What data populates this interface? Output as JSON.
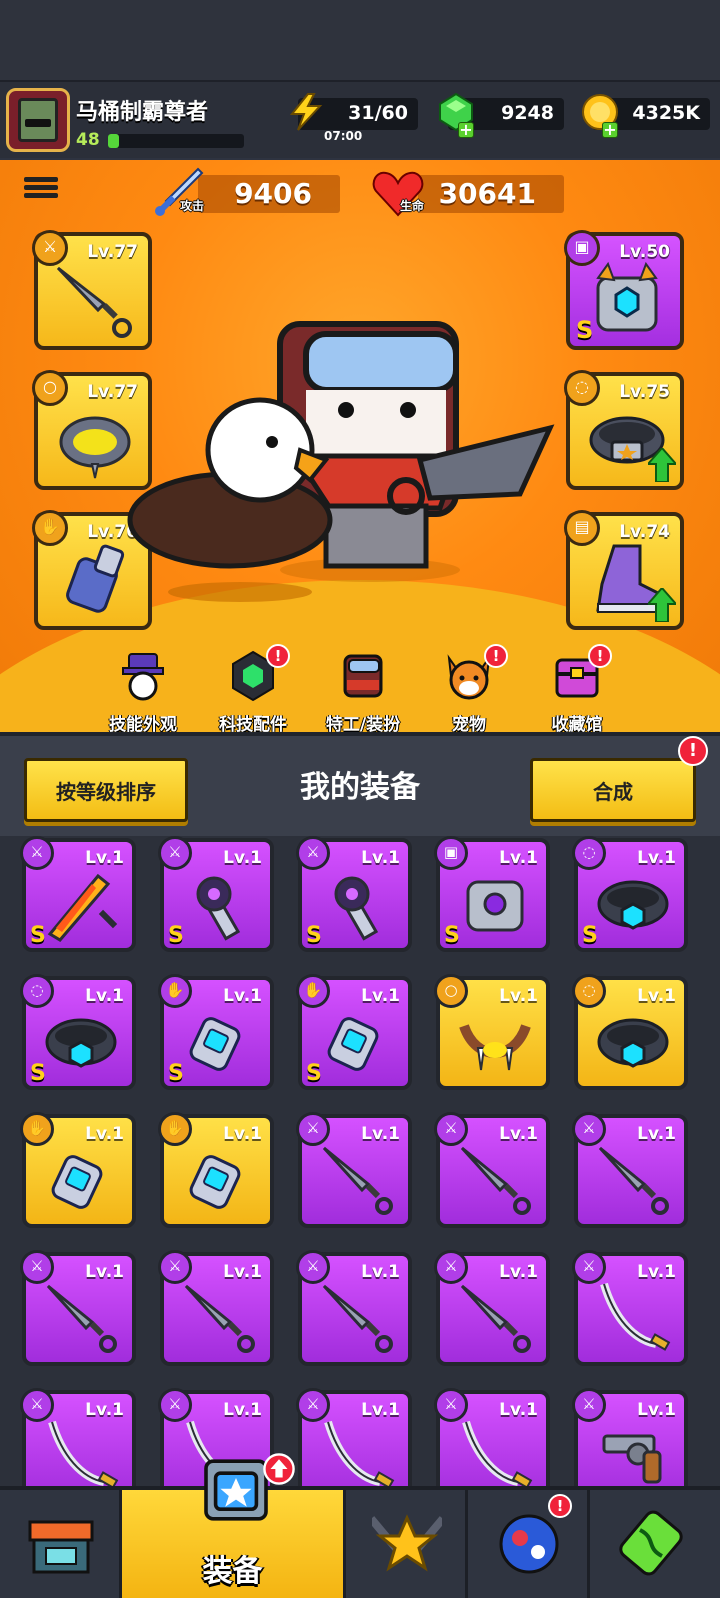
{
  "player": {
    "name": "马桶制霸尊者",
    "level": "48",
    "xp_fraction": 0.08
  },
  "resources": {
    "energy": {
      "value": "31/60",
      "timer": "07:00",
      "icon": "lightning-icon"
    },
    "gems": {
      "value": "9248",
      "icon": "green-gem-icon"
    },
    "gold": {
      "value": "4325K",
      "icon": "gold-coin-icon"
    }
  },
  "stats": {
    "attack": {
      "value": "9406",
      "tag": "攻击",
      "icon": "sword-icon"
    },
    "health": {
      "value": "30641",
      "tag": "生命",
      "icon": "heart-icon"
    }
  },
  "equipped": {
    "weapon": {
      "lv": "Lv.77",
      "icon": "kunai-icon",
      "rarity": "gold"
    },
    "necklace": {
      "lv": "Lv.77",
      "icon": "necklace-icon",
      "rarity": "gold"
    },
    "gloves": {
      "lv": "Lv.76",
      "icon": "glove-icon",
      "rarity": "gold"
    },
    "armor": {
      "lv": "Lv.50",
      "icon": "armor-icon",
      "rarity": "purple",
      "rank": "S"
    },
    "belt": {
      "lv": "Lv.75",
      "icon": "belt-icon",
      "rarity": "gold"
    },
    "boots": {
      "lv": "Lv.74",
      "icon": "boots-icon",
      "rarity": "gold"
    }
  },
  "features": [
    {
      "label": "技能外观",
      "icon": "skill-skin-icon",
      "badge": ""
    },
    {
      "label": "科技配件",
      "icon": "tech-part-icon",
      "badge": "!"
    },
    {
      "label": "特工/装扮",
      "icon": "agent-icon",
      "badge": ""
    },
    {
      "label": "宠物",
      "icon": "pet-icon",
      "badge": "!"
    },
    {
      "label": "收藏馆",
      "icon": "collection-icon",
      "badge": "!"
    }
  ],
  "inventory_header": {
    "sort_label": "按等级排序",
    "title": "我的装备",
    "merge_label": "合成",
    "merge_badge": "!"
  },
  "inventory": [
    {
      "lv": "Lv.1",
      "type": "weapon",
      "icon": "flame-sword-icon",
      "rarity": "purple",
      "rank": "S"
    },
    {
      "lv": "Lv.1",
      "type": "weapon",
      "icon": "shuriken-blade-icon",
      "rarity": "purple",
      "rank": "S"
    },
    {
      "lv": "Lv.1",
      "type": "weapon",
      "icon": "shuriken-blade-icon",
      "rarity": "purple",
      "rank": "S"
    },
    {
      "lv": "Lv.1",
      "type": "armor",
      "icon": "armor-icon",
      "rarity": "purple",
      "rank": "S"
    },
    {
      "lv": "Lv.1",
      "type": "belt",
      "icon": "belt-icon",
      "rarity": "purple",
      "rank": "S"
    },
    {
      "lv": "Lv.1",
      "type": "belt",
      "icon": "belt-icon",
      "rarity": "purple",
      "rank": "S"
    },
    {
      "lv": "Lv.1",
      "type": "glove",
      "icon": "glove-icon",
      "rarity": "purple",
      "rank": "S"
    },
    {
      "lv": "Lv.1",
      "type": "glove",
      "icon": "glove-icon",
      "rarity": "purple",
      "rank": "S"
    },
    {
      "lv": "Lv.1",
      "type": "necklace",
      "icon": "fang-necklace-icon",
      "rarity": "gold",
      "rank": ""
    },
    {
      "lv": "Lv.1",
      "type": "belt",
      "icon": "belt-icon",
      "rarity": "gold",
      "rank": ""
    },
    {
      "lv": "Lv.1",
      "type": "glove",
      "icon": "glove-icon",
      "rarity": "gold",
      "rank": ""
    },
    {
      "lv": "Lv.1",
      "type": "glove",
      "icon": "glove-icon",
      "rarity": "gold",
      "rank": ""
    },
    {
      "lv": "Lv.1",
      "type": "weapon",
      "icon": "kunai-icon",
      "rarity": "purple",
      "rank": ""
    },
    {
      "lv": "Lv.1",
      "type": "weapon",
      "icon": "kunai-icon",
      "rarity": "purple",
      "rank": ""
    },
    {
      "lv": "Lv.1",
      "type": "weapon",
      "icon": "kunai-icon",
      "rarity": "purple",
      "rank": ""
    },
    {
      "lv": "Lv.1",
      "type": "weapon",
      "icon": "kunai-icon",
      "rarity": "purple",
      "rank": ""
    },
    {
      "lv": "Lv.1",
      "type": "weapon",
      "icon": "kunai-icon",
      "rarity": "purple",
      "rank": ""
    },
    {
      "lv": "Lv.1",
      "type": "weapon",
      "icon": "kunai-icon",
      "rarity": "purple",
      "rank": ""
    },
    {
      "lv": "Lv.1",
      "type": "weapon",
      "icon": "kunai-icon",
      "rarity": "purple",
      "rank": ""
    },
    {
      "lv": "Lv.1",
      "type": "weapon",
      "icon": "katana-icon",
      "rarity": "purple",
      "rank": ""
    },
    {
      "lv": "Lv.1",
      "type": "weapon",
      "icon": "katana-icon",
      "rarity": "purple",
      "rank": ""
    },
    {
      "lv": "Lv.1",
      "type": "weapon",
      "icon": "katana-icon",
      "rarity": "purple",
      "rank": ""
    },
    {
      "lv": "Lv.1",
      "type": "weapon",
      "icon": "katana-icon",
      "rarity": "purple",
      "rank": ""
    },
    {
      "lv": "Lv.1",
      "type": "weapon",
      "icon": "katana-icon",
      "rarity": "purple",
      "rank": ""
    },
    {
      "lv": "Lv.1",
      "type": "weapon",
      "icon": "revolver-icon",
      "rarity": "purple",
      "rank": ""
    }
  ],
  "nav": [
    {
      "label": "",
      "icon": "shop-icon",
      "active": false
    },
    {
      "label": "装备",
      "icon": "equipment-icon",
      "active": true
    },
    {
      "label": "",
      "icon": "battle-star-icon",
      "active": false
    },
    {
      "label": "",
      "icon": "planet-icon",
      "active": false,
      "badge": "!"
    },
    {
      "label": "",
      "icon": "dna-icon",
      "active": false
    }
  ],
  "colors": {
    "gold_card": "#f6b81a",
    "purple_card": "#a42fe0",
    "stage_bg": "#ff8a12",
    "badge_red": "#f0223a"
  }
}
